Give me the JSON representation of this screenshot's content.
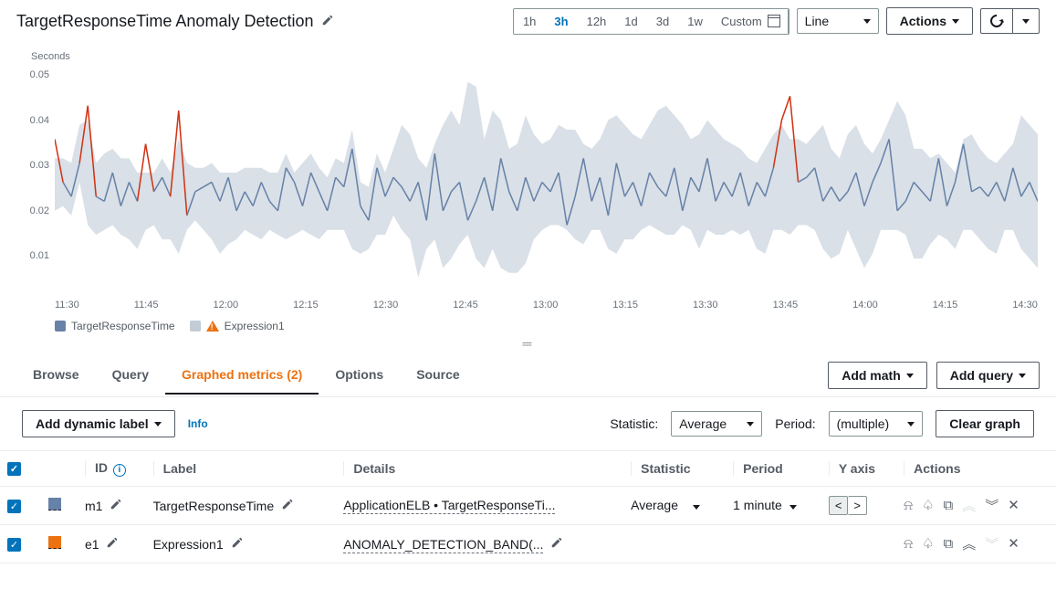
{
  "header": {
    "title": "TargetResponseTime Anomaly Detection",
    "time_ranges": [
      "1h",
      "3h",
      "12h",
      "1d",
      "3d",
      "1w",
      "Custom"
    ],
    "active_range": "3h",
    "chart_type": "Line",
    "actions_label": "Actions"
  },
  "chart_data": {
    "type": "line_with_band",
    "title": "",
    "ylabel": "Seconds",
    "ylim": [
      0.008,
      0.052
    ],
    "yticks": [
      0.01,
      0.02,
      0.03,
      0.04,
      0.05
    ],
    "x_categories": [
      "11:30",
      "11:45",
      "12:00",
      "12:15",
      "12:30",
      "12:45",
      "13:00",
      "13:15",
      "13:30",
      "13:45",
      "14:00",
      "14:15",
      "14:30"
    ],
    "series": [
      {
        "name": "TargetResponseTime",
        "color": "#6782a8"
      },
      {
        "name": "Expression1",
        "color": "#c2ccd6",
        "warning": true
      }
    ],
    "band_upper": [
      0.033,
      0.033,
      0.032,
      0.04,
      0.041,
      0.032,
      0.034,
      0.035,
      0.033,
      0.033,
      0.03,
      0.03,
      0.03,
      0.033,
      0.03,
      0.037,
      0.032,
      0.031,
      0.031,
      0.032,
      0.03,
      0.03,
      0.03,
      0.031,
      0.031,
      0.031,
      0.03,
      0.03,
      0.034,
      0.03,
      0.032,
      0.034,
      0.031,
      0.029,
      0.033,
      0.032,
      0.039,
      0.028,
      0.027,
      0.034,
      0.03,
      0.035,
      0.04,
      0.038,
      0.033,
      0.031,
      0.036,
      0.04,
      0.043,
      0.04,
      0.049,
      0.048,
      0.037,
      0.043,
      0.041,
      0.035,
      0.036,
      0.042,
      0.038,
      0.036,
      0.037,
      0.04,
      0.039,
      0.039,
      0.036,
      0.035,
      0.037,
      0.041,
      0.042,
      0.04,
      0.038,
      0.037,
      0.04,
      0.043,
      0.044,
      0.042,
      0.04,
      0.037,
      0.038,
      0.041,
      0.039,
      0.037,
      0.036,
      0.035,
      0.033,
      0.032,
      0.035,
      0.038,
      0.04,
      0.037,
      0.037,
      0.036,
      0.038,
      0.04,
      0.035,
      0.033,
      0.038,
      0.04,
      0.036,
      0.034,
      0.037,
      0.041,
      0.045,
      0.042,
      0.035,
      0.035,
      0.033,
      0.034,
      0.032,
      0.03,
      0.037,
      0.038,
      0.035,
      0.033,
      0.032,
      0.034,
      0.036,
      0.042,
      0.04,
      0.038
    ],
    "band_lower": [
      0.022,
      0.023,
      0.021,
      0.028,
      0.019,
      0.017,
      0.018,
      0.019,
      0.017,
      0.016,
      0.014,
      0.018,
      0.019,
      0.016,
      0.016,
      0.013,
      0.018,
      0.02,
      0.018,
      0.016,
      0.013,
      0.015,
      0.016,
      0.018,
      0.017,
      0.016,
      0.018,
      0.017,
      0.016,
      0.017,
      0.018,
      0.017,
      0.016,
      0.018,
      0.018,
      0.018,
      0.014,
      0.013,
      0.014,
      0.017,
      0.017,
      0.021,
      0.018,
      0.016,
      0.008,
      0.014,
      0.016,
      0.01,
      0.012,
      0.015,
      0.017,
      0.012,
      0.01,
      0.014,
      0.01,
      0.009,
      0.009,
      0.011,
      0.016,
      0.018,
      0.019,
      0.019,
      0.018,
      0.016,
      0.015,
      0.018,
      0.018,
      0.014,
      0.013,
      0.016,
      0.016,
      0.018,
      0.019,
      0.018,
      0.017,
      0.017,
      0.019,
      0.018,
      0.014,
      0.018,
      0.017,
      0.017,
      0.018,
      0.017,
      0.018,
      0.014,
      0.013,
      0.018,
      0.018,
      0.017,
      0.019,
      0.019,
      0.018,
      0.014,
      0.012,
      0.013,
      0.018,
      0.014,
      0.01,
      0.013,
      0.018,
      0.018,
      0.018,
      0.017,
      0.012,
      0.012,
      0.015,
      0.017,
      0.016,
      0.014,
      0.018,
      0.018,
      0.016,
      0.014,
      0.013,
      0.018,
      0.018,
      0.014,
      0.012,
      0.01
    ],
    "line_values": [
      0.037,
      0.028,
      0.025,
      0.032,
      0.044,
      0.025,
      0.024,
      0.03,
      0.023,
      0.028,
      0.024,
      0.036,
      0.026,
      0.029,
      0.025,
      0.043,
      0.021,
      0.026,
      0.027,
      0.028,
      0.024,
      0.029,
      0.022,
      0.026,
      0.023,
      0.028,
      0.024,
      0.022,
      0.031,
      0.028,
      0.023,
      0.03,
      0.026,
      0.022,
      0.029,
      0.027,
      0.035,
      0.023,
      0.02,
      0.031,
      0.025,
      0.029,
      0.027,
      0.024,
      0.028,
      0.02,
      0.034,
      0.022,
      0.026,
      0.028,
      0.02,
      0.024,
      0.029,
      0.022,
      0.033,
      0.026,
      0.022,
      0.029,
      0.024,
      0.028,
      0.026,
      0.03,
      0.019,
      0.025,
      0.033,
      0.024,
      0.029,
      0.021,
      0.032,
      0.025,
      0.028,
      0.023,
      0.03,
      0.027,
      0.025,
      0.031,
      0.022,
      0.029,
      0.026,
      0.033,
      0.024,
      0.028,
      0.025,
      0.03,
      0.023,
      0.028,
      0.025,
      0.031,
      0.041,
      0.046,
      0.028,
      0.029,
      0.031,
      0.024,
      0.027,
      0.024,
      0.026,
      0.03,
      0.023,
      0.028,
      0.032,
      0.037,
      0.022,
      0.024,
      0.028,
      0.026,
      0.024,
      0.033,
      0.023,
      0.028,
      0.036,
      0.026,
      0.027,
      0.025,
      0.028,
      0.024,
      0.031,
      0.025,
      0.028,
      0.024
    ]
  },
  "legend": {
    "item1": "TargetResponseTime",
    "item2": "Expression1"
  },
  "tabs": {
    "browse": "Browse",
    "query": "Query",
    "graphed": "Graphed metrics (2)",
    "options": "Options",
    "source": "Source",
    "add_math": "Add math",
    "add_query": "Add query"
  },
  "controls": {
    "add_dynamic": "Add dynamic label",
    "info": "Info",
    "statistic_label": "Statistic:",
    "statistic_value": "Average",
    "period_label": "Period:",
    "period_value": "(multiple)",
    "clear_graph": "Clear graph"
  },
  "table": {
    "headers": {
      "id": "ID",
      "label": "Label",
      "details": "Details",
      "statistic": "Statistic",
      "period": "Period",
      "yaxis": "Y axis",
      "actions": "Actions"
    },
    "rows": [
      {
        "id": "m1",
        "label": "TargetResponseTime",
        "details": "ApplicationELB • TargetResponseTi...",
        "statistic": "Average",
        "period": "1 minute",
        "color": "sq-m1",
        "yaxis_left": true
      },
      {
        "id": "e1",
        "label": "Expression1",
        "details": "ANOMALY_DETECTION_BAND(...",
        "statistic": "",
        "period": "",
        "color": "sq-e1",
        "yaxis_left": false
      }
    ]
  }
}
